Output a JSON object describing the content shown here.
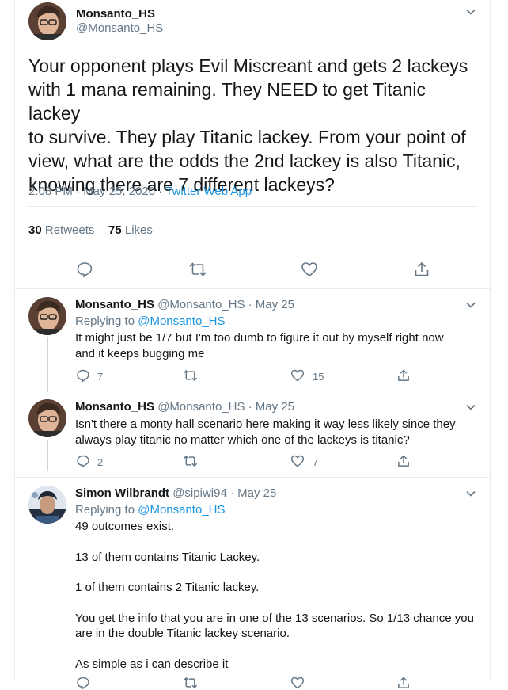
{
  "main_tweet": {
    "name": "Monsanto_HS",
    "handle": "@Monsanto_HS",
    "text": "Your opponent plays Evil Miscreant and gets 2 lackeys\nwith 1 mana remaining. They NEED to get Titanic lackey\nto survive. They play Titanic lackey. From your point of\nview, what are the odds the 2nd lackey is also Titanic,\nknowing there are 7 different lackeys?",
    "timestamp": "2:08 PM · May 25, 2020 · ",
    "source": "Twitter Web App",
    "retweets_count": "30",
    "retweets_label": "Retweets",
    "likes_count": "75",
    "likes_label": "Likes"
  },
  "replies": [
    {
      "name": "Monsanto_HS",
      "handle_date": "@Monsanto_HS · May 25",
      "replying_prefix": "Replying to ",
      "replying_to": "@Monsanto_HS",
      "text": "It might just be 1/7 but I'm too dumb to figure it out by myself right now\nand it keeps bugging me",
      "reply_count": "7",
      "retweet_count": "",
      "like_count": "15"
    },
    {
      "name": "Monsanto_HS",
      "handle_date": "@Monsanto_HS · May 25",
      "text": "Isn't there a monty hall scenario here making it way less likely since they\nalways play titanic no matter which one of the lackeys is titanic?",
      "reply_count": "2",
      "retweet_count": "",
      "like_count": "7"
    },
    {
      "name": "Simon Wilbrandt",
      "handle_date": "@sipiwi94 · May 25",
      "replying_prefix": "Replying to ",
      "replying_to": "@Monsanto_HS",
      "text": "49 outcomes exist.\n\n13 of them contains Titanic Lackey.\n\n1 of them contains 2 Titanic lackey.\n\nYou get the info that you are in one of the 13 scenarios. So 1/13 chance you\nare in the double Titanic lackey scenario.\n\nAs simple as i can describe it"
    }
  ],
  "icons": [
    "chevron-down-icon",
    "reply-icon",
    "retweet-icon",
    "like-icon",
    "share-icon"
  ],
  "colors": {
    "link": "#1b95e0",
    "secondary": "#657786",
    "divider": "#e6ecf0",
    "thread": "#ccd6dd"
  }
}
